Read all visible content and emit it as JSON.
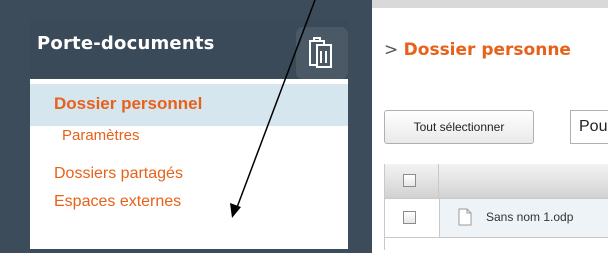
{
  "sidebar": {
    "title": "Porte-documents",
    "icon": "briefcase-icon",
    "items": [
      {
        "label": "Dossier personnel",
        "active": true
      },
      {
        "label": "Paramètres"
      },
      {
        "label": "Dossiers partagés"
      },
      {
        "label": "Espaces externes"
      }
    ]
  },
  "breadcrumb": {
    "separator": ">",
    "current": "Dossier personne"
  },
  "toolbar": {
    "select_all_label": "Tout sélectionner",
    "select_value": "Pou"
  },
  "table": {
    "rows": [
      {
        "name": "Sans nom 1.odp",
        "icon": "document-icon"
      }
    ]
  },
  "colors": {
    "panel": "#3c4c5a",
    "accent": "#e8611a",
    "active_item_bg": "#d6e6ee"
  }
}
